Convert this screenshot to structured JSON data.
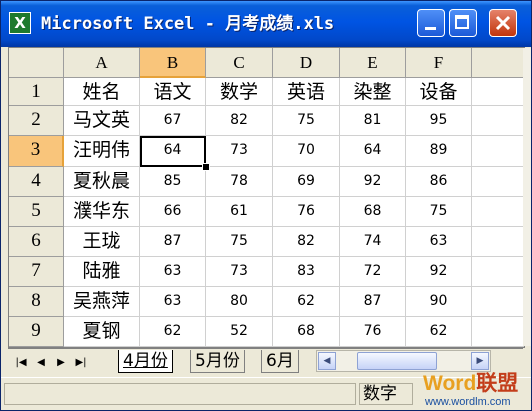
{
  "window": {
    "title": "Microsoft Excel - 月考成绩.xls",
    "icon_glyph": "X",
    "icons": [
      "excel-icon",
      "minimize-icon",
      "maximize-icon",
      "close-icon"
    ]
  },
  "spreadsheet": {
    "columns": [
      "A",
      "B",
      "C",
      "D",
      "E",
      "F"
    ],
    "rows": [
      "1",
      "2",
      "3",
      "4",
      "5",
      "6",
      "7",
      "8",
      "9"
    ],
    "selected_cell": "B3",
    "data": [
      [
        "姓名",
        "语文",
        "数学",
        "英语",
        "染整",
        "设备"
      ],
      [
        "马文英",
        "67",
        "82",
        "75",
        "81",
        "95"
      ],
      [
        "汪明伟",
        "64",
        "73",
        "70",
        "64",
        "89"
      ],
      [
        "夏秋晨",
        "85",
        "78",
        "69",
        "92",
        "86"
      ],
      [
        "濮华东",
        "66",
        "61",
        "76",
        "68",
        "75"
      ],
      [
        "王珑",
        "87",
        "75",
        "82",
        "74",
        "63"
      ],
      [
        "陆雅",
        "63",
        "73",
        "83",
        "72",
        "92"
      ],
      [
        "吴燕萍",
        "63",
        "80",
        "62",
        "87",
        "90"
      ],
      [
        "夏钢",
        "62",
        "52",
        "68",
        "76",
        "62"
      ]
    ]
  },
  "sheet_tabs": {
    "nav_glyphs": [
      "|◀",
      "◀",
      "▶",
      "▶|"
    ],
    "tabs": [
      "4月份",
      "5月份",
      "6月"
    ],
    "active_tab": "4月份"
  },
  "statusbar": {
    "mode": "数字"
  },
  "watermark": {
    "brand_word": "Word",
    "brand_cn": "联盟",
    "url": "www.wordlm.com"
  }
}
